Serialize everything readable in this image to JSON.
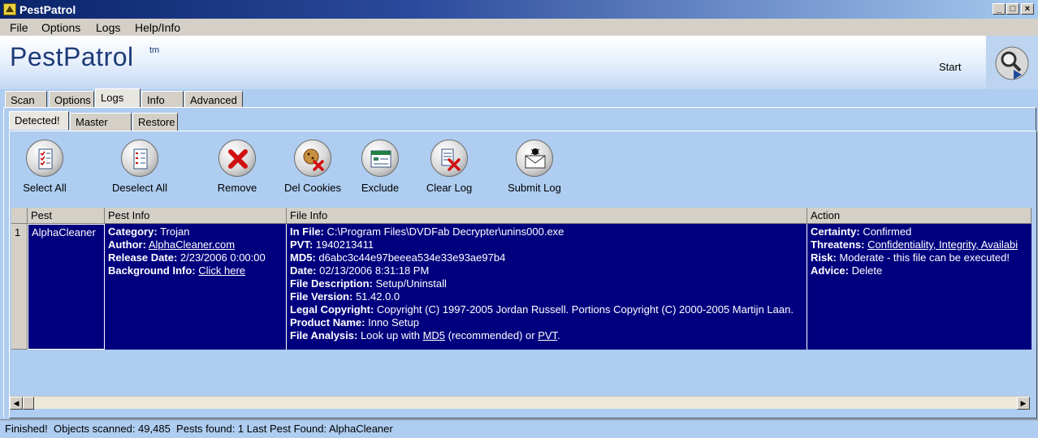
{
  "window": {
    "title": "PestPatrol",
    "minimize": "_",
    "maximize": "□",
    "close": "×"
  },
  "menu": [
    "File",
    "Options",
    "Logs",
    "Help/Info"
  ],
  "banner": {
    "logo": "PestPatrol",
    "tm": "tm",
    "start_label": "Start"
  },
  "tabs": [
    "Scan",
    "Options",
    "Logs",
    "Info",
    "Advanced"
  ],
  "active_tab": "Logs",
  "subtabs": [
    "Detected!",
    "Master Log",
    "Restore"
  ],
  "active_subtab": "Detected!",
  "toolbar": {
    "select_all": "Select All",
    "deselect_all": "Deselect All",
    "remove": "Remove",
    "del_cookies": "Del Cookies",
    "exclude": "Exclude",
    "clear_log": "Clear Log",
    "submit_log": "Submit Log"
  },
  "grid": {
    "columns": [
      "Pest",
      "Pest Info",
      "File Info",
      "Action"
    ],
    "rows": [
      {
        "num": "1",
        "pest": "AlphaCleaner",
        "pest_info": {
          "category_label": "Category:",
          "category": "Trojan",
          "author_label": "Author:",
          "author": "AlphaCleaner.com",
          "release_label": "Release Date:",
          "release": "2/23/2006 0:00:00",
          "background_label": "Background Info:",
          "background": "Click here"
        },
        "file_info": {
          "in_file_label": "In File:",
          "in_file": "C:\\Program Files\\DVDFab Decrypter\\unins000.exe",
          "pvt_label": "PVT:",
          "pvt": "1940213411",
          "md5_label": "MD5:",
          "md5": "d6abc3c44e97beeea534e33e93ae97b4",
          "date_label": "Date:",
          "date": "02/13/2006 8:31:18 PM",
          "desc_label": "File Description:",
          "desc": "Setup/Uninstall",
          "version_label": "File Version:",
          "version": "51.42.0.0",
          "copyright_label": "Legal Copyright:",
          "copyright": "Copyright (C) 1997-2005 Jordan Russell. Portions Copyright (C) 2000-2005 Martijn Laan.",
          "product_label": "Product Name:",
          "product": "Inno Setup",
          "analysis_label": "File Analysis:",
          "analysis_pre": "Look up with",
          "analysis_md5": "MD5",
          "analysis_mid": "(recommended) or",
          "analysis_pvt": "PVT",
          "analysis_end": "."
        },
        "action": {
          "certainty_label": "Certainty:",
          "certainty": "Confirmed",
          "threatens_label": "Threatens:",
          "threatens": "Confidentiality, Integrity, Availabi",
          "risk_label": "Risk:",
          "risk": "Moderate - this file can be executed!",
          "advice_label": "Advice:",
          "advice": "Delete"
        }
      }
    ]
  },
  "status": {
    "state": "Finished!",
    "objects_scanned": "Objects scanned: 49,485",
    "pests_found": "Pests found: 1 Last Pest Found: AlphaCleaner"
  },
  "colors": {
    "selection": "#00007f",
    "background": "#aecdf0",
    "titlebar": "#0a246a"
  }
}
